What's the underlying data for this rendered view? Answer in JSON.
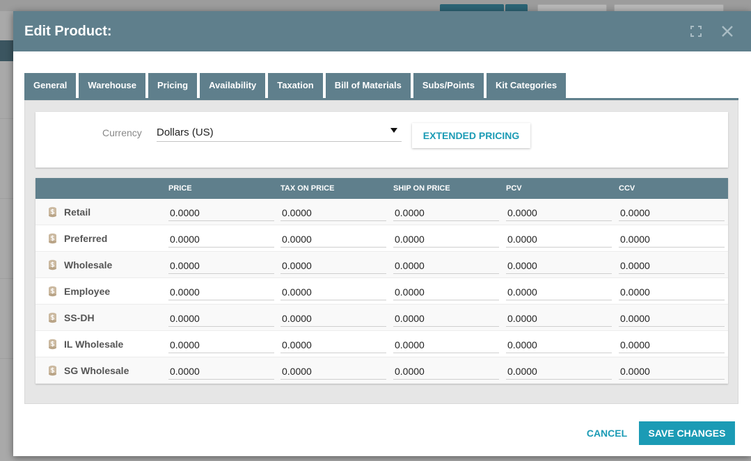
{
  "modal": {
    "title": "Edit Product:"
  },
  "tabs": [
    {
      "label": "General"
    },
    {
      "label": "Warehouse"
    },
    {
      "label": "Pricing"
    },
    {
      "label": "Availability"
    },
    {
      "label": "Taxation"
    },
    {
      "label": "Bill of Materials"
    },
    {
      "label": "Subs/Points"
    },
    {
      "label": "Kit Categories"
    }
  ],
  "active_tab": "Pricing",
  "currency": {
    "label": "Currency",
    "value": "Dollars (US)"
  },
  "extended_pricing_label": "EXTENDED PRICING",
  "table": {
    "columns": [
      "PRICE",
      "TAX ON PRICE",
      "SHIP ON PRICE",
      "PCV",
      "CCV"
    ],
    "rows": [
      {
        "label": "Retail",
        "values": [
          "0.0000",
          "0.0000",
          "0.0000",
          "0.0000",
          "0.0000"
        ]
      },
      {
        "label": "Preferred",
        "values": [
          "0.0000",
          "0.0000",
          "0.0000",
          "0.0000",
          "0.0000"
        ]
      },
      {
        "label": "Wholesale",
        "values": [
          "0.0000",
          "0.0000",
          "0.0000",
          "0.0000",
          "0.0000"
        ]
      },
      {
        "label": "Employee",
        "values": [
          "0.0000",
          "0.0000",
          "0.0000",
          "0.0000",
          "0.0000"
        ]
      },
      {
        "label": "SS-DH",
        "values": [
          "0.0000",
          "0.0000",
          "0.0000",
          "0.0000",
          "0.0000"
        ]
      },
      {
        "label": "IL Wholesale",
        "values": [
          "0.0000",
          "0.0000",
          "0.0000",
          "0.0000",
          "0.0000"
        ]
      },
      {
        "label": "SG Wholesale",
        "values": [
          "0.0000",
          "0.0000",
          "0.0000",
          "0.0000",
          "0.0000"
        ]
      }
    ]
  },
  "footer": {
    "cancel_label": "CANCEL",
    "save_label": "SAVE CHANGES"
  },
  "colors": {
    "header": "#5f7f8c",
    "accent": "#1b9bb5"
  },
  "icons": {
    "row": "dollar-coin-icon",
    "expand": "expand-icon",
    "close": "close-icon"
  }
}
